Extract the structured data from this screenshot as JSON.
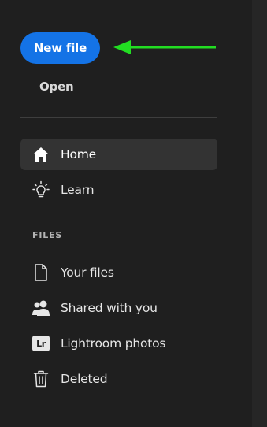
{
  "primary_action": {
    "new_file_label": "New file",
    "open_label": "Open"
  },
  "nav": {
    "items": [
      {
        "label": "Home",
        "icon": "home-icon",
        "active": true
      },
      {
        "label": "Learn",
        "icon": "lightbulb-icon",
        "active": false
      }
    ]
  },
  "files_section": {
    "heading": "FILES",
    "items": [
      {
        "label": "Your files",
        "icon": "document-icon"
      },
      {
        "label": "Shared with you",
        "icon": "people-icon"
      },
      {
        "label": "Lightroom photos",
        "icon": "lightroom-icon",
        "badge": "Lr"
      },
      {
        "label": "Deleted",
        "icon": "trash-icon"
      }
    ]
  },
  "colors": {
    "background": "#1f1f1f",
    "accent_blue": "#1473e6",
    "arrow_green": "#22dd22",
    "active_item_bg": "#333333"
  }
}
